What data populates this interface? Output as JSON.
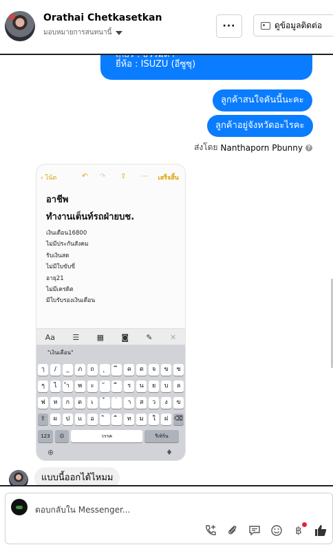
{
  "header": {
    "contact_name": "Orathai Chetkasetkan",
    "assignment": "มอบหมายการสนทนานี้",
    "more_label": "···",
    "view_contact_label": "ดูข้อมูลติดต่อ"
  },
  "messages": {
    "partial_line_1": "เกียร์ : ธรรมดา",
    "partial_line_2": "ยี่ห้อ : ISUZU (อีซูซุ)",
    "out_1": "ลูกค้าสนใจคันนี้นะคะ",
    "out_2": "ลูกค้าอยู่จังหวัดอะไรคะ",
    "sent_by_prefix": "ส่งโดย",
    "sent_by_name": "Nanthaporn Pbunny",
    "in_1": "แบบนี้ออกได้ไหมม"
  },
  "screenshot": {
    "back_label": "โน้ต",
    "done_label": "เสร็จสิ้น",
    "note_title": "อาชีพ",
    "note_subtitle": "ทำงานเต็นท์รถฝ่ายบช.",
    "note_lines": [
      "เงินเดือน16800",
      "ไม่มีประกันสังคม",
      "รับเงินสด",
      "ไม่มีใบขับขี่",
      "อายุ21",
      "ไม่มีเครดิต",
      "มีใบรับรองเงินเดือน"
    ],
    "format_aa": "Aa",
    "suggestion": "\"เงินเดือน\"",
    "row1": [
      "ๅ",
      "/",
      "_",
      "ภ",
      "ถ",
      "ุ",
      "ึ",
      "ค",
      "ต",
      "จ",
      "ข",
      "ช"
    ],
    "row2": [
      "ๆ",
      "ไ",
      "ำ",
      "พ",
      "ะ",
      "ั",
      "ี",
      "ร",
      "น",
      "ย",
      "บ",
      "ล"
    ],
    "row3": [
      "ฟ",
      "ห",
      "ก",
      "ด",
      "เ",
      "้",
      "่",
      "า",
      "ส",
      "ว",
      "ง",
      "ข"
    ],
    "row4": [
      "ผ",
      "ป",
      "แ",
      "อ",
      "ิ",
      "ื",
      "ท",
      "ม",
      "ใ",
      "ฝ"
    ],
    "key_123": "123",
    "key_space": "วรรค",
    "key_return": "รีเทิร์น"
  },
  "composer": {
    "placeholder": "ตอบกลับใน Messenger..."
  },
  "colors": {
    "outgoing_bubble": "#0a7cff",
    "incoming_bubble": "#f0f0f0",
    "notes_accent": "#d9a300"
  }
}
